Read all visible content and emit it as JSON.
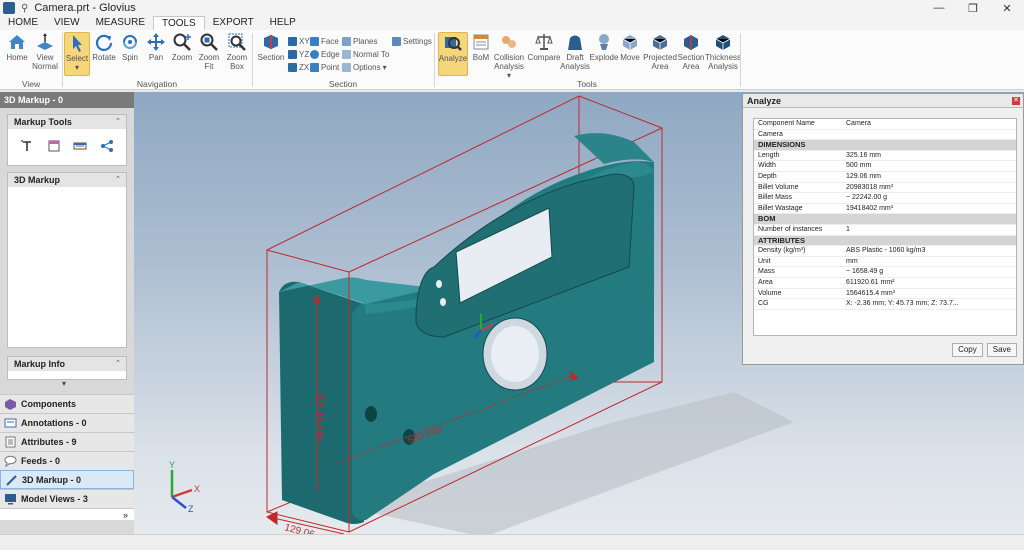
{
  "window": {
    "title": "Camera.prt - Glovius",
    "pin_glyph": "⚲",
    "controls": [
      "—",
      "❐",
      "✕"
    ]
  },
  "menu_tabs": [
    "HOME",
    "VIEW",
    "MEASURE",
    "TOOLS",
    "EXPORT",
    "HELP"
  ],
  "ribbon": {
    "view": {
      "label": "View",
      "home": "Home",
      "view_normal": "View Normal"
    },
    "navigation": {
      "label": "Navigation",
      "select": "Select",
      "rotate": "Rotate",
      "spin": "Spin",
      "pan": "Pan",
      "zoom": "Zoom",
      "zoom_fit": "Zoom Fit",
      "zoom_box": "Zoom Box"
    },
    "section": {
      "label": "Section",
      "section": "Section",
      "xy": "XY",
      "yz": "YZ",
      "zx": "ZX",
      "face": "Face",
      "edge": "Edge",
      "point": "Point",
      "planes": "Planes",
      "normal_to": "Normal To",
      "options": "Options",
      "settings": "Settings"
    },
    "tools": {
      "label": "Tools",
      "analyze": "Analyze",
      "bom": "BoM",
      "collision_analysis": "Collision Analysis",
      "compare": "Compare",
      "draft_analysis": "Draft Analysis",
      "explode": "Explode",
      "move": "Move",
      "projected_area": "Projected Area",
      "section_area": "Section Area",
      "thickness_analysis": "Thickness Analysis"
    }
  },
  "left_panel": {
    "title": "3D Markup - 0",
    "markup_tools": "Markup Tools",
    "markup_list": "3D Markup",
    "markup_info": "Markup Info",
    "collapse_glyph": "⌃",
    "dropdown_glyph": "▾",
    "more_glyph": "»",
    "nav": [
      {
        "label": "Components",
        "icon": "components-icon"
      },
      {
        "label": "Annotations - 0",
        "icon": "annotations-icon"
      },
      {
        "label": "Attributes - 9",
        "icon": "attributes-icon"
      },
      {
        "label": "Feeds - 0",
        "icon": "feeds-icon"
      },
      {
        "label": "3D Markup - 0",
        "icon": "markup-icon"
      },
      {
        "label": "Model Views - 3",
        "icon": "model-views-icon"
      }
    ]
  },
  "viewport": {
    "dim_height": "325.16 mm",
    "dim_width": "500 mm",
    "dim_depth": "129.06",
    "triad": {
      "x": "X",
      "y": "Y",
      "z": "Z"
    }
  },
  "analyze": {
    "title": "Analyze",
    "close_glyph": "✕",
    "rows": [
      {
        "type": "row",
        "k": "Component Name",
        "v": "Camera"
      },
      {
        "type": "row",
        "k": "Camera",
        "v": ""
      },
      {
        "type": "section",
        "k": "DIMENSIONS"
      },
      {
        "type": "row",
        "k": "Length",
        "v": "325.16 mm"
      },
      {
        "type": "row",
        "k": "Width",
        "v": "500 mm"
      },
      {
        "type": "row",
        "k": "Depth",
        "v": "129.06 mm"
      },
      {
        "type": "row",
        "k": "Billet Volume",
        "v": "20983018 mm³"
      },
      {
        "type": "row",
        "k": "Billet Mass",
        "v": "~ 22242.00 g"
      },
      {
        "type": "row",
        "k": "Billet Wastage",
        "v": "19418402 mm³"
      },
      {
        "type": "section",
        "k": "BOM"
      },
      {
        "type": "row",
        "k": "Number of instances",
        "v": "1"
      },
      {
        "type": "section",
        "k": "ATTRIBUTES"
      },
      {
        "type": "row",
        "k": "Density (kg/m³)",
        "v": "ABS Plastic - 1060 kg/m3"
      },
      {
        "type": "row",
        "k": "Unit",
        "v": "mm"
      },
      {
        "type": "row",
        "k": "Mass",
        "v": "~ 1658.49 g"
      },
      {
        "type": "row",
        "k": "Area",
        "v": "611920.61  mm²"
      },
      {
        "type": "row",
        "k": "Volume",
        "v": "1564615.4  mm³"
      },
      {
        "type": "row",
        "k": "CG",
        "v": "X: -2.36  mm; Y: 45.73  mm; Z: 73.7..."
      }
    ],
    "copy": "Copy",
    "save": "Save"
  },
  "colors": {
    "model": "#1f6f73",
    "accent": "#f6d67a",
    "bbox": "#c0282d"
  }
}
